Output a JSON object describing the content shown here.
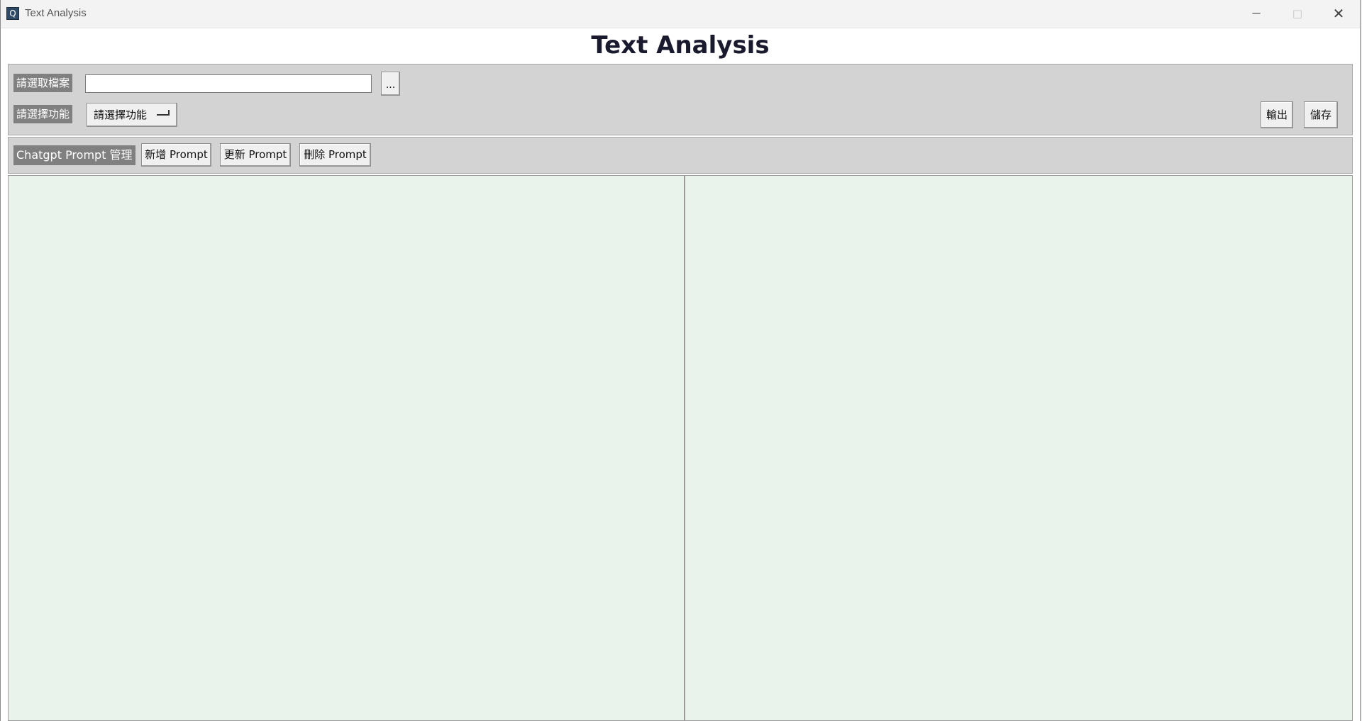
{
  "window": {
    "title": "Text Analysis",
    "icon": "app-icon",
    "controls": {
      "minimize": "─",
      "maximize": "□",
      "close": "✕"
    }
  },
  "heading": "Text Analysis",
  "file_row": {
    "label": "請選取檔案",
    "input_value": "",
    "browse_label": "..."
  },
  "function_row": {
    "label": "請選擇功能",
    "selected": "請選擇功能",
    "export_label": "輸出",
    "save_label": "儲存"
  },
  "prompt_row": {
    "label": "Chatgpt Prompt 管理",
    "add_label": "新增 Prompt",
    "update_label": "更新 Prompt",
    "delete_label": "刪除 Prompt"
  },
  "panes": {
    "input_text": "",
    "output_text": ""
  },
  "colors": {
    "panel_bg": "#d3d3d3",
    "label_bg": "#808080",
    "pane_bg": "#e9f3eb"
  }
}
